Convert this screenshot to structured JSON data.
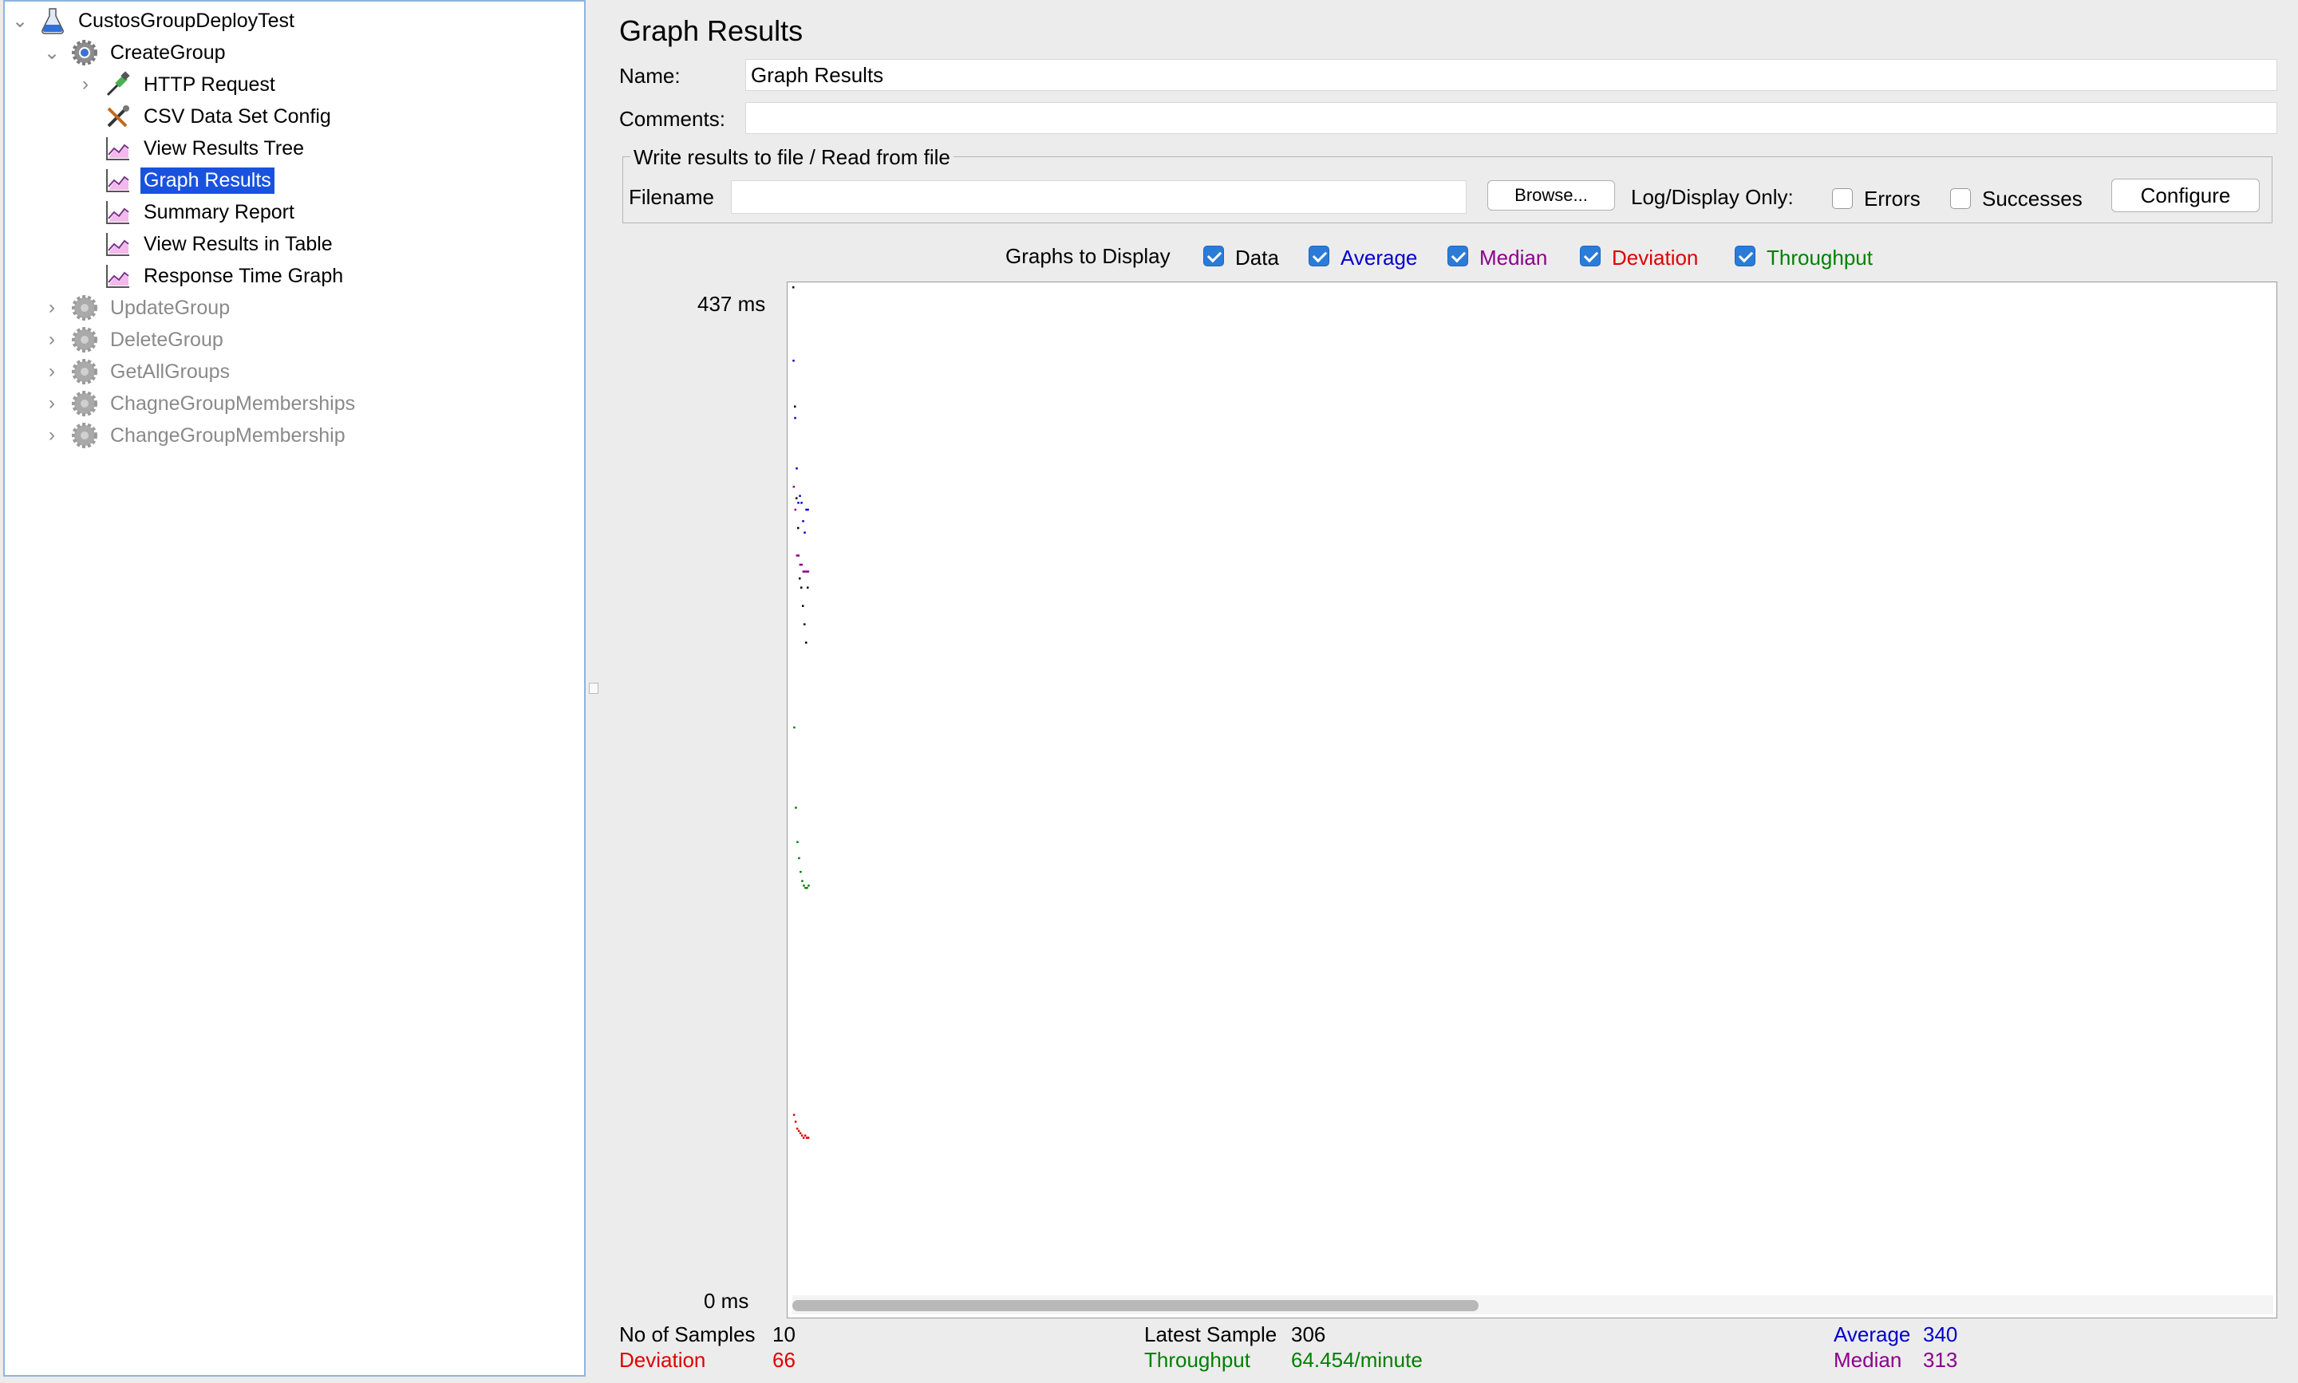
{
  "tree": {
    "root": {
      "label": "CustosGroupDeployTest"
    },
    "group": {
      "label": "CreateGroup"
    },
    "children": [
      {
        "label": "HTTP Request",
        "icon": "pipette-icon",
        "expandable": true
      },
      {
        "label": "CSV Data Set Config",
        "icon": "tools-icon",
        "expandable": false
      },
      {
        "label": "View Results Tree",
        "icon": "graph-icon",
        "expandable": false
      },
      {
        "label": "Graph Results",
        "icon": "graph-icon",
        "expandable": false,
        "selected": true
      },
      {
        "label": "Summary Report",
        "icon": "graph-icon",
        "expandable": false
      },
      {
        "label": "View Results in Table",
        "icon": "graph-icon",
        "expandable": false
      },
      {
        "label": "Response Time Graph",
        "icon": "graph-icon",
        "expandable": false
      }
    ],
    "disabled_groups": [
      {
        "label": "UpdateGroup"
      },
      {
        "label": "DeleteGroup"
      },
      {
        "label": "GetAllGroups"
      },
      {
        "label": "ChagneGroupMemberships"
      },
      {
        "label": "ChangeGroupMembership"
      }
    ]
  },
  "panel": {
    "title": "Graph Results",
    "name_label": "Name:",
    "name_value": "Graph Results",
    "comments_label": "Comments:",
    "comments_value": "",
    "file_group_label": "Write results to file / Read from file",
    "filename_label": "Filename",
    "filename_value": "",
    "browse_label": "Browse...",
    "log_display_label": "Log/Display Only:",
    "errors_label": "Errors",
    "successes_label": "Successes",
    "configure_label": "Configure"
  },
  "graphs_to_display": {
    "label": "Graphs to Display",
    "options": [
      {
        "label": "Data",
        "checked": true,
        "color": "#000000"
      },
      {
        "label": "Average",
        "checked": true,
        "color": "#0000cc"
      },
      {
        "label": "Median",
        "checked": true,
        "color": "#8b008b"
      },
      {
        "label": "Deviation",
        "checked": true,
        "color": "#e00000"
      },
      {
        "label": "Throughput",
        "checked": true,
        "color": "#008000"
      }
    ]
  },
  "chart_data": {
    "type": "scatter",
    "y_axis_max_label": "437  ms",
    "y_axis_min_label": "0  ms",
    "ylim": [
      0,
      437
    ],
    "series": [
      {
        "name": "Data",
        "color": "#000000",
        "x": [
          1,
          2,
          3,
          4,
          5,
          6,
          7,
          8,
          9,
          10
        ],
        "y": [
          437,
          385,
          345,
          332,
          310,
          306,
          298,
          290,
          282,
          306
        ]
      },
      {
        "name": "Average",
        "color": "#0000cc",
        "x": [
          1,
          2,
          3,
          4,
          5,
          6,
          7,
          8,
          9,
          10
        ],
        "y": [
          405,
          380,
          358,
          343,
          346,
          343,
          335,
          330,
          340,
          340
        ]
      },
      {
        "name": "Median",
        "color": "#8b008b",
        "x": [
          1,
          2,
          3,
          4,
          5,
          6,
          7,
          8,
          9,
          10
        ],
        "y": [
          350,
          340,
          320,
          320,
          316,
          316,
          313,
          313,
          313,
          313
        ]
      },
      {
        "name": "Deviation",
        "color": "#e00000",
        "x": [
          1,
          2,
          3,
          4,
          5,
          6,
          7,
          8,
          9,
          10
        ],
        "y": [
          76,
          73,
          70,
          69,
          68,
          67,
          66,
          67,
          66,
          66
        ]
      },
      {
        "name": "Throughput",
        "color": "#008000",
        "x": [
          1,
          2,
          3,
          4,
          5,
          6,
          7,
          8,
          9,
          10
        ],
        "y": [
          245,
          210,
          195,
          188,
          182,
          178,
          176,
          175,
          175,
          176
        ]
      }
    ]
  },
  "stats": {
    "samples_label": "No of Samples",
    "samples_value": "10",
    "latest_label": "Latest Sample",
    "latest_value": "306",
    "average_label": "Average",
    "average_value": "340",
    "deviation_label": "Deviation",
    "deviation_value": "66",
    "throughput_label": "Throughput",
    "throughput_value": "64.454/minute",
    "median_label": "Median",
    "median_value": "313"
  }
}
